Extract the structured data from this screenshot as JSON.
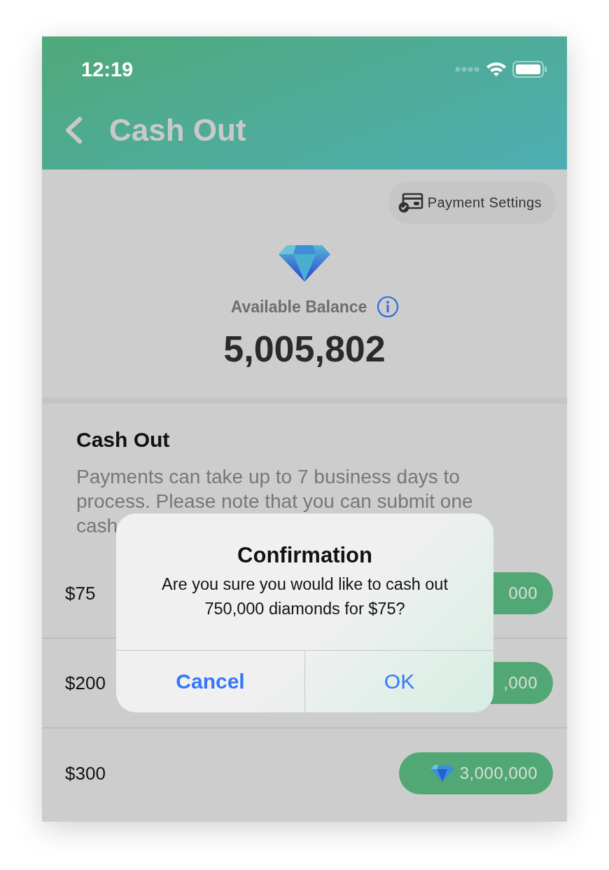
{
  "status_bar": {
    "time": "12:19"
  },
  "nav": {
    "title": "Cash Out"
  },
  "payment_settings": {
    "label": "Payment Settings"
  },
  "balance": {
    "label": "Available Balance",
    "amount": "5,005,802"
  },
  "cash_out": {
    "title": "Cash Out",
    "description": "Payments can take up to 7 business days to process. Please note that you can submit one cash"
  },
  "options": [
    {
      "amount": "$75",
      "price": "000",
      "diamond_icon": false
    },
    {
      "amount": "$200",
      "price": ",000",
      "diamond_icon": false
    },
    {
      "amount": "$300",
      "price": "3,000,000",
      "diamond_icon": true
    }
  ],
  "dialog": {
    "title": "Confirmation",
    "message": "Are you sure you would like to cash out 750,000 diamonds for $75?",
    "buttons": [
      {
        "label": "Cancel",
        "kind": "cancel"
      },
      {
        "label": "OK",
        "kind": "default"
      }
    ]
  }
}
